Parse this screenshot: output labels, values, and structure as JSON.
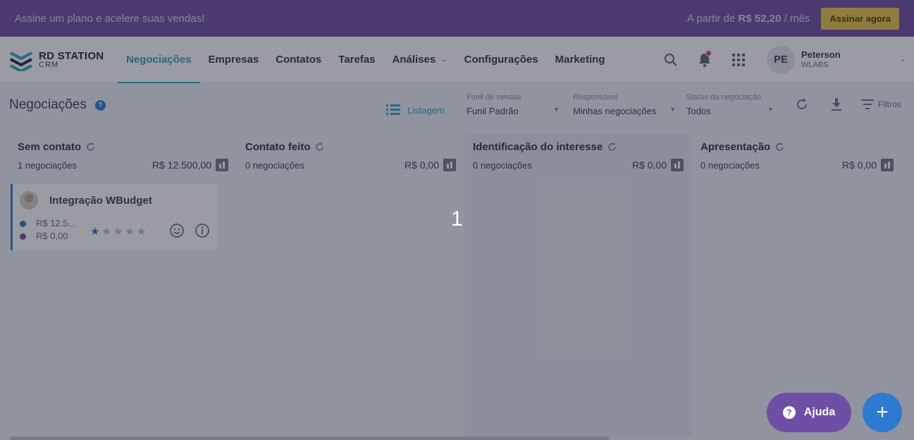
{
  "promo": {
    "message": "Assine um plano e acelere suas vendas!",
    "price_prefix": "A partir de",
    "price_value": "R$ 52,20",
    "price_suffix": "/ mês",
    "cta": "Assinar agora"
  },
  "header": {
    "logo_main": "RD STATION",
    "logo_sub": "CRM",
    "nav": [
      "Negociações",
      "Empresas",
      "Contatos",
      "Tarefas",
      "Análises",
      "Configurações",
      "Marketing"
    ],
    "active_nav": "Negociações",
    "user_initials": "PE",
    "user_name": "Peterson",
    "user_company": "WLABS"
  },
  "toolbar": {
    "title": "Negociações",
    "view_label": "Listagem",
    "filters": [
      {
        "label": "Funil de vendas",
        "value": "Funil Padrão"
      },
      {
        "label": "Responsável",
        "value": "Minhas negociações"
      },
      {
        "label": "Status da negociação",
        "value": "Todos"
      }
    ],
    "filtros_label": "Filtros"
  },
  "columns": [
    {
      "title": "Sem contato",
      "count": "1 negociações",
      "total": "R$ 12.500,00"
    },
    {
      "title": "Contato feito",
      "count": "0 negociações",
      "total": "R$ 0,00"
    },
    {
      "title": "Identificação do interesse",
      "count": "0 negociações",
      "total": "R$ 0,00"
    },
    {
      "title": "Apresentação",
      "count": "0 negociações",
      "total": "R$ 0,00"
    }
  ],
  "card": {
    "title": "Integração WBudget",
    "value_one": "R$ 12.5...",
    "value_two": "R$ 0,00",
    "rating": 1,
    "rating_max": 5,
    "color_one": "#2d7ad1",
    "color_two": "#7a4fa6"
  },
  "overlay": {
    "step": "1"
  },
  "floating": {
    "help_label": "Ajuda",
    "add_icon": "plus-icon"
  }
}
